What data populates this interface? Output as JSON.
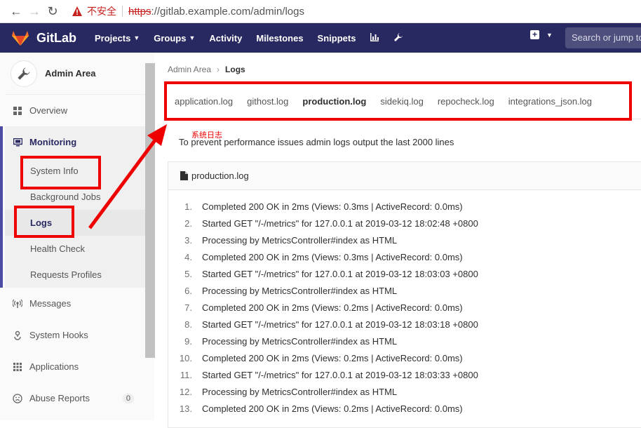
{
  "browser": {
    "insecure_label": "不安全",
    "url_scheme": "https",
    "url_rest": "://gitlab.example.com/admin/logs"
  },
  "header": {
    "logo_text": "GitLab",
    "nav": [
      "Projects",
      "Groups",
      "Activity",
      "Milestones",
      "Snippets"
    ],
    "search_placeholder": "Search or jump to"
  },
  "sidebar": {
    "title": "Admin Area",
    "overview": "Overview",
    "monitoring": "Monitoring",
    "monitoring_items": [
      "System Info",
      "Background Jobs",
      "Logs",
      "Health Check",
      "Requests Profiles"
    ],
    "messages": "Messages",
    "system_hooks": "System Hooks",
    "applications": "Applications",
    "abuse_reports": "Abuse Reports",
    "abuse_count": "0"
  },
  "main": {
    "breadcrumb_parent": "Admin Area",
    "breadcrumb_current": "Logs",
    "tabs": [
      "application.log",
      "githost.log",
      "production.log",
      "sidekiq.log",
      "repocheck.log",
      "integrations_json.log"
    ],
    "active_tab": "production.log",
    "annotation": "系统日志",
    "info": "To prevent performance issues admin logs output the last 2000 lines",
    "log_file": "production.log",
    "lines": [
      {
        "n": "1.",
        "t": "Completed 200 OK in 2ms (Views: 0.3ms | ActiveRecord: 0.0ms)"
      },
      {
        "n": "2.",
        "t": "Started GET \"/-/metrics\" for 127.0.0.1 at 2019-03-12 18:02:48 +0800"
      },
      {
        "n": "3.",
        "t": "Processing by MetricsController#index as HTML"
      },
      {
        "n": "4.",
        "t": "Completed 200 OK in 2ms (Views: 0.3ms | ActiveRecord: 0.0ms)"
      },
      {
        "n": "5.",
        "t": "Started GET \"/-/metrics\" for 127.0.0.1 at 2019-03-12 18:03:03 +0800"
      },
      {
        "n": "6.",
        "t": "Processing by MetricsController#index as HTML"
      },
      {
        "n": "7.",
        "t": "Completed 200 OK in 2ms (Views: 0.2ms | ActiveRecord: 0.0ms)"
      },
      {
        "n": "8.",
        "t": "Started GET \"/-/metrics\" for 127.0.0.1 at 2019-03-12 18:03:18 +0800"
      },
      {
        "n": "9.",
        "t": "Processing by MetricsController#index as HTML"
      },
      {
        "n": "10.",
        "t": "Completed 200 OK in 2ms (Views: 0.2ms | ActiveRecord: 0.0ms)"
      },
      {
        "n": "11.",
        "t": "Started GET \"/-/metrics\" for 127.0.0.1 at 2019-03-12 18:03:33 +0800"
      },
      {
        "n": "12.",
        "t": "Processing by MetricsController#index as HTML"
      },
      {
        "n": "13.",
        "t": "Completed 200 OK in 2ms (Views: 0.2ms | ActiveRecord: 0.0ms)"
      }
    ]
  },
  "colors": {
    "header_bg": "#292961",
    "annotation_red": "#ee0000",
    "active_tab_underline": "#1f78d1"
  }
}
